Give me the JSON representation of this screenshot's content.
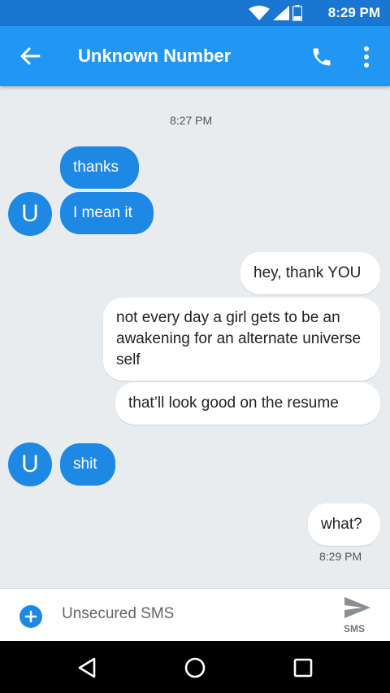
{
  "status_bar": {
    "time": "8:29 PM",
    "icons": [
      "wifi-icon",
      "signal-icon",
      "battery-icon"
    ]
  },
  "app_bar": {
    "title": "Unknown Number",
    "back_icon": "arrow-left-icon",
    "call_icon": "phone-icon",
    "more_icon": "more-vert-icon"
  },
  "thread": {
    "top_timestamp": "8:27 PM",
    "avatar_letter": "U",
    "messages": [
      {
        "dir": "in",
        "text": "thanks"
      },
      {
        "dir": "in",
        "text": "I mean it"
      },
      {
        "dir": "out",
        "text": "hey, thank YOU"
      },
      {
        "dir": "out",
        "text": "not every day a girl gets to be an awakening for an alternate universe self"
      },
      {
        "dir": "out",
        "text": "that’ll look good on the resume"
      },
      {
        "dir": "in",
        "text": "shit"
      },
      {
        "dir": "out",
        "text": "what?"
      }
    ],
    "bottom_timestamp": "8:29 PM"
  },
  "composer": {
    "placeholder": "Unsecured SMS",
    "send_label": "SMS"
  },
  "nav_bar": {
    "icons": [
      "back-triangle-icon",
      "home-circle-icon",
      "recents-square-icon"
    ]
  },
  "colors": {
    "accent": "#2196f3",
    "incoming": "#1e88e5",
    "status_bar": "#1976d2"
  }
}
